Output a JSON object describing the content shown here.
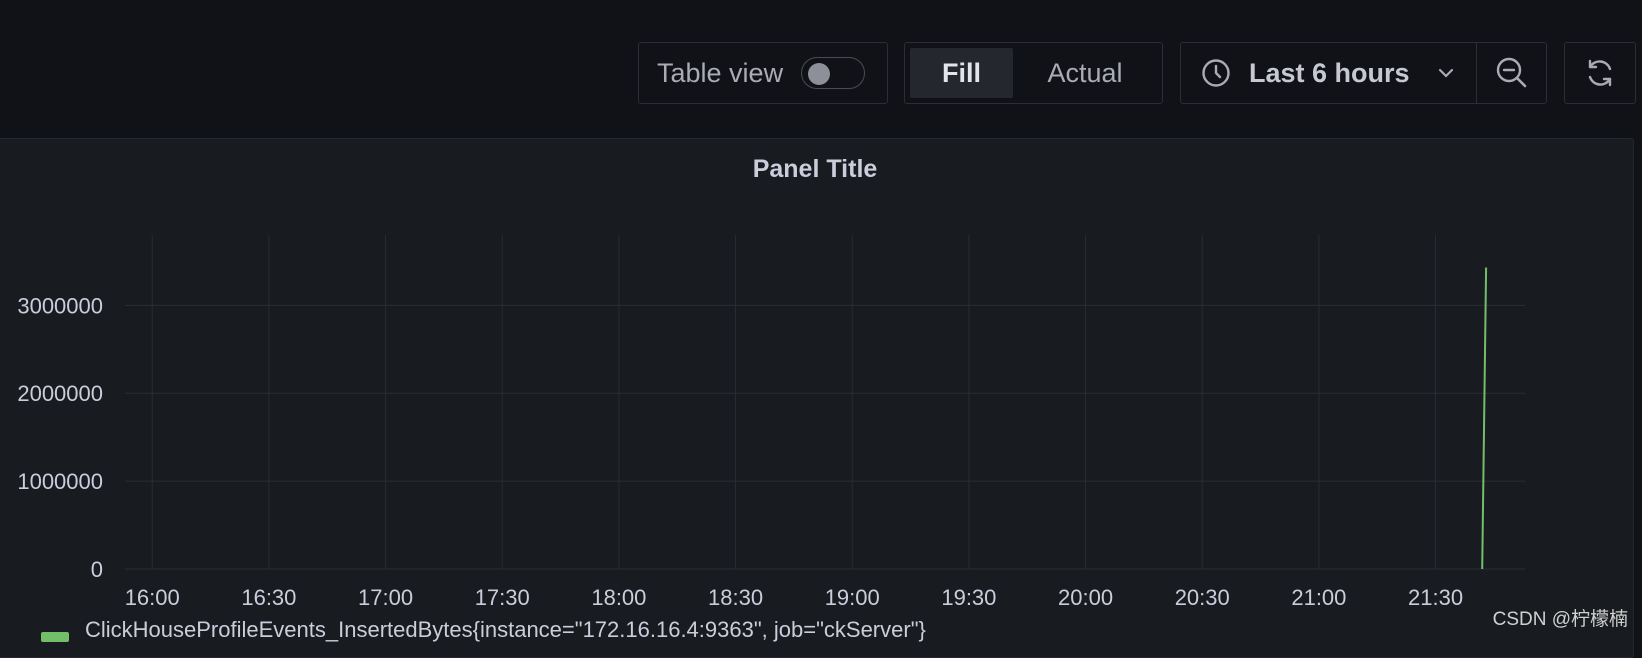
{
  "toolbar": {
    "table_view_label": "Table view",
    "table_view_on": false,
    "fill_label": "Fill",
    "actual_label": "Actual",
    "time_range": "Last 6 hours"
  },
  "panel": {
    "title": "Panel Title",
    "legend": "ClickHouseProfileEvents_InsertedBytes{instance=\"172.16.16.4:9363\", job=\"ckServer\"}"
  },
  "chart_data": {
    "type": "line",
    "x_ticks": [
      "16:00",
      "16:30",
      "17:00",
      "17:30",
      "18:00",
      "18:30",
      "19:00",
      "19:30",
      "20:00",
      "20:30",
      "21:00",
      "21:30"
    ],
    "y_ticks": [
      0,
      1000000,
      2000000,
      3000000
    ],
    "ylim": [
      0,
      3800000
    ],
    "xlim": [
      "15:53",
      "21:53"
    ],
    "grid": true,
    "legend_position": "bottom-left",
    "series": [
      {
        "name": "ClickHouseProfileEvents_InsertedBytes{instance=\"172.16.16.4:9363\", job=\"ckServer\"}",
        "color": "#73bf69",
        "x": [
          "21:42",
          "21:43"
        ],
        "y": [
          0,
          3430000
        ]
      }
    ]
  },
  "watermark": "CSDN @柠檬楠"
}
